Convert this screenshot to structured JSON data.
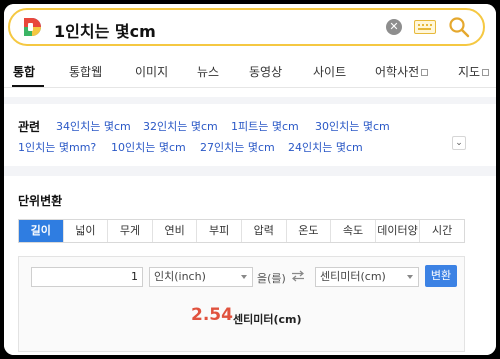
{
  "search": {
    "query": "1인치는 몇cm",
    "clear_symbol": "✕"
  },
  "nav_tabs": [
    {
      "label": "통합",
      "active": true
    },
    {
      "label": "통합웹"
    },
    {
      "label": "이미지"
    },
    {
      "label": "뉴스"
    },
    {
      "label": "동영상"
    },
    {
      "label": "사이트"
    },
    {
      "label": "어학사전"
    },
    {
      "label": "지도"
    }
  ],
  "related": {
    "title": "관련",
    "links": [
      "34인치는 몇cm",
      "32인치는 몇cm",
      "1피트는 몇cm",
      "30인치는 몇cm",
      "1인치는 몇mm?",
      "10인치는 몇cm",
      "27인치는 몇cm",
      "24인치는 몇cm"
    ],
    "expand_symbol": "⌄"
  },
  "converter": {
    "title": "단위변환",
    "unit_tabs": [
      "길이",
      "넓이",
      "무게",
      "연비",
      "부피",
      "압력",
      "온도",
      "속도",
      "데이터양",
      "시간"
    ],
    "active_tab": 0,
    "input_value": "1",
    "from_unit": "인치(inch)",
    "eul": "을(를)",
    "to_unit": "센티미터(cm)",
    "convert_label": "변환",
    "result_value": "2.54",
    "result_unit": "센티미터(cm)"
  },
  "colors": {
    "accent": "#2f7de1",
    "search_border": "#f5c842",
    "link": "#2a58c6",
    "result": "#e0523e"
  },
  "icons": {
    "logo": "daum-logo-icon",
    "clear": "clear-icon",
    "keyboard": "keyboard-icon",
    "search": "search-icon",
    "swap": "swap-icon",
    "expand": "chevron-down-icon",
    "external": "external-link-icon"
  }
}
